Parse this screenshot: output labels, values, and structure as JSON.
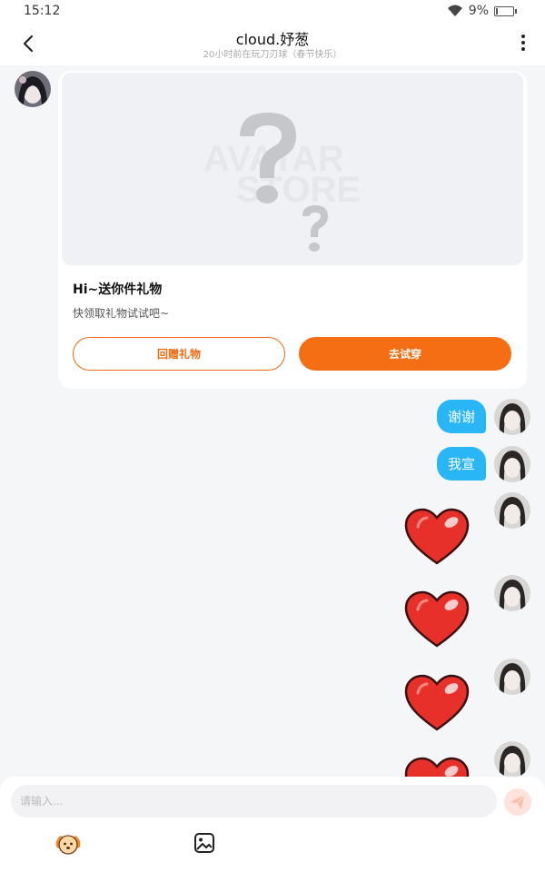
{
  "status": {
    "time": "15:12",
    "battery": "9%",
    "battery_level": 0.09
  },
  "header": {
    "title": "cloud.妤葱",
    "subtitle": "20小时前在玩刀刃球（春节快乐）"
  },
  "card": {
    "title": "Hi~送你件礼物",
    "desc": "快领取礼物试试吧~",
    "return_gift_label": "回赠礼物",
    "try_on_label": "去试穿",
    "image_watermark": "AVATAR STORE"
  },
  "messages": [
    {
      "text": "谢谢"
    },
    {
      "text": "我宣"
    }
  ],
  "hearts_count": 4,
  "input": {
    "placeholder": "请输入..."
  },
  "icons": {
    "back": "chevron-left-icon",
    "more": "more-vertical-icon",
    "send": "send-icon",
    "emoji": "dog-emoji-icon",
    "image": "image-icon"
  },
  "colors": {
    "accent": "#f56e14",
    "bubble": "#29b6f6",
    "heart": "#e8302a"
  }
}
